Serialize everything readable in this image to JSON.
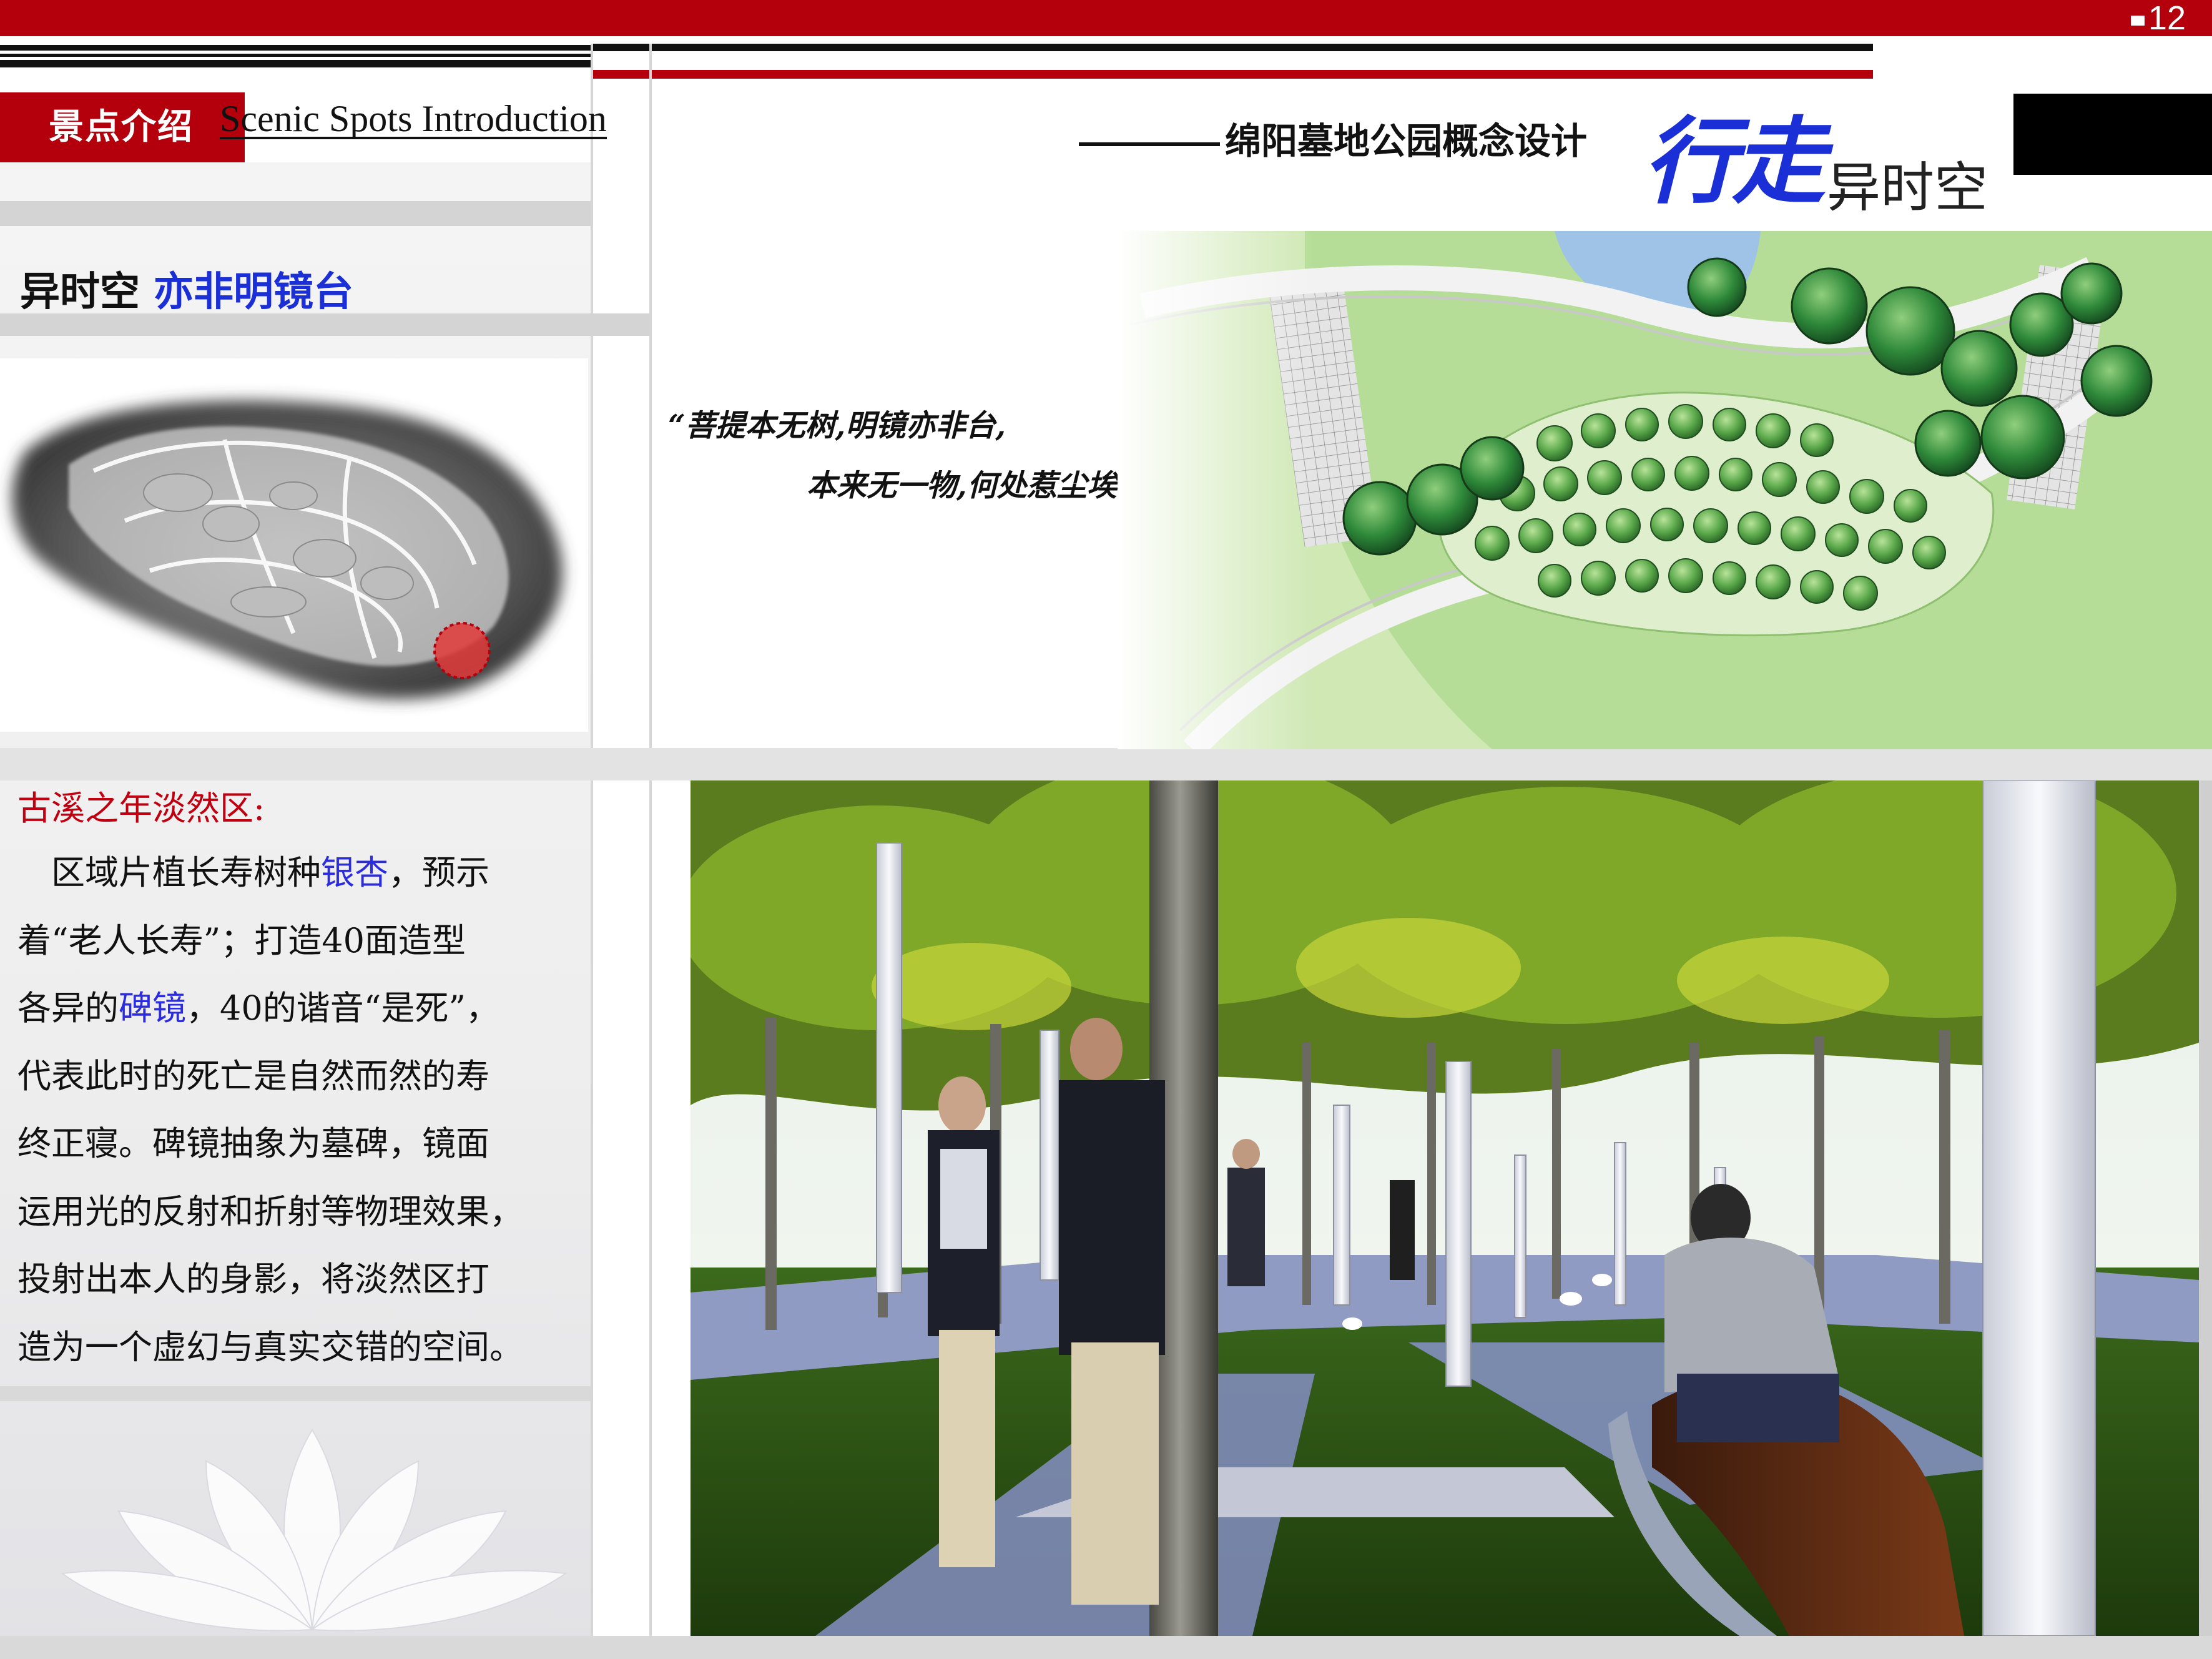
{
  "header": {
    "page_number": "12",
    "section_title_cn": "景点介绍",
    "section_title_en": "Scenic Spots Introduction",
    "project_title": "绵阳墓地公园概念设计",
    "logo_big": "行走",
    "logo_small": "异时空",
    "brand_red": "#b3000c"
  },
  "spot": {
    "title_a": "异时空",
    "title_b": "亦非明镜台"
  },
  "quote": {
    "line1": "“菩提本无树,明镜亦非台,",
    "line2": "本来无一物,何处惹尘埃。”"
  },
  "zone": {
    "title": "古溪之年淡然区:",
    "lines": [
      [
        {
          "t": "　区域片植长寿树种"
        },
        {
          "t": "银杏",
          "hl": true
        },
        {
          "t": "，预示"
        }
      ],
      [
        {
          "t": "着“老人长寿”；打造40面造型"
        }
      ],
      [
        {
          "t": "各异的"
        },
        {
          "t": "碑镜",
          "hl": true
        },
        {
          "t": "，40的谐音“是死”，"
        }
      ],
      [
        {
          "t": "代表此时的死亡是自然而然的寿"
        }
      ],
      [
        {
          "t": "终正寝。碑镜抽象为墓碑，镜面"
        }
      ],
      [
        {
          "t": "运用光的反射和折射等物理效果，"
        }
      ],
      [
        {
          "t": "投射出本人的身影，将淡然区打"
        }
      ],
      [
        {
          "t": "造为一个虚幻与真实交错的空间。"
        }
      ]
    ],
    "highlight_color": "#2b2be0"
  },
  "images": {
    "site_map": "site-map-ink-wash",
    "plan": "planting-plan-watercolor",
    "render": "ginkgo-grove-mirror-render",
    "lotus": "lotus-watermark"
  }
}
